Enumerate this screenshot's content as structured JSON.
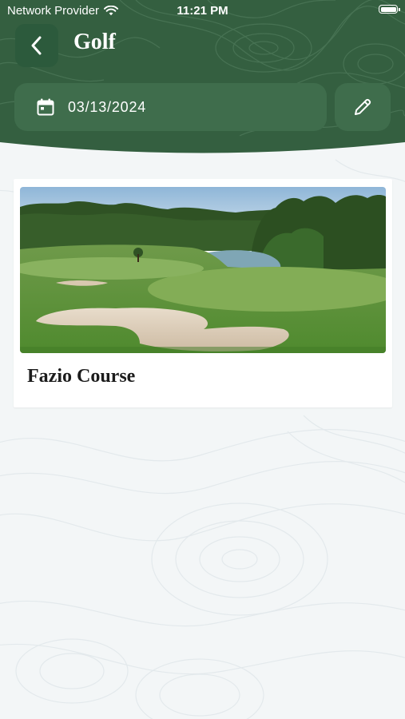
{
  "status_bar": {
    "carrier": "Network Provider",
    "time": "11:21 PM",
    "icons": [
      "wifi-icon",
      "battery-icon"
    ]
  },
  "header": {
    "title": "Golf",
    "back_icon": "chevron-left-icon"
  },
  "date_field": {
    "icon": "calendar-icon",
    "value": "03/13/2024"
  },
  "edit_button": {
    "icon": "pencil-icon"
  },
  "courses": [
    {
      "name": "Fazio Course",
      "image": "golf-course-photo"
    }
  ],
  "colors": {
    "header_green": "#345f40",
    "button_green": "#3f6d4c",
    "back_button": "#2c5a3c",
    "page_background": "#f3f6f7",
    "card_background": "#ffffff"
  }
}
